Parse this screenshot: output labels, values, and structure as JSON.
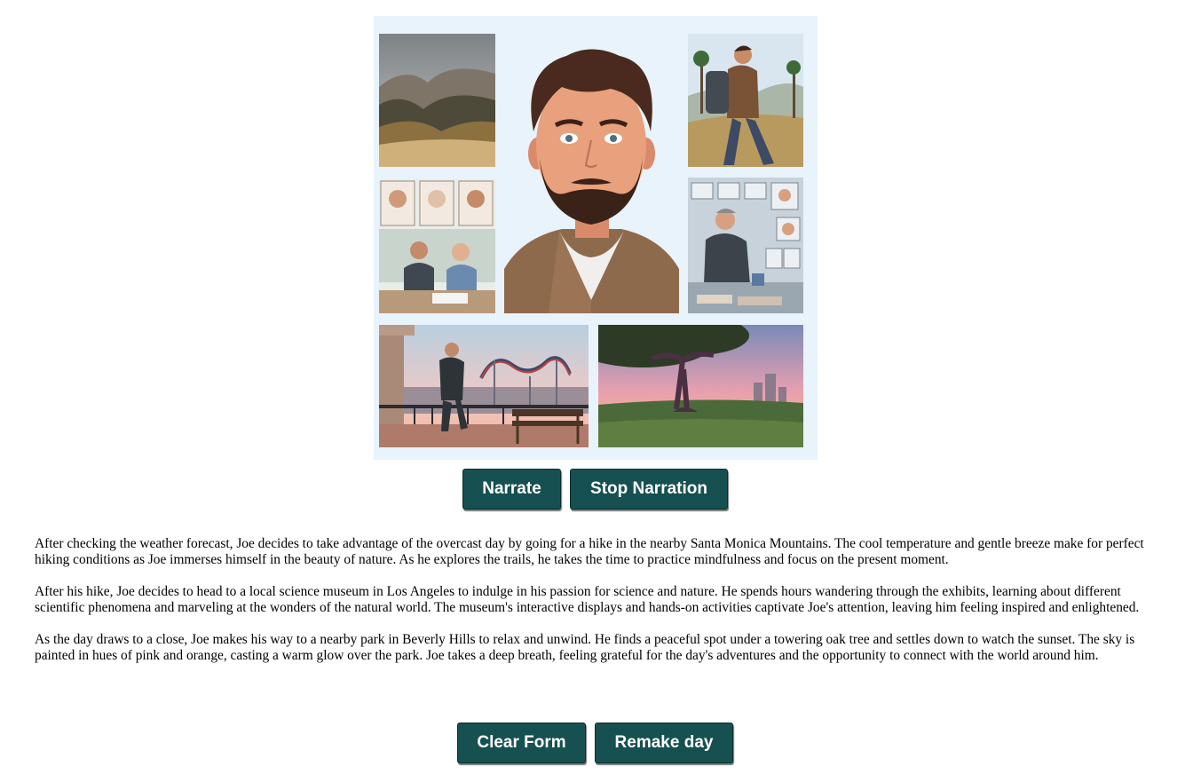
{
  "colors": {
    "button_bg": "#175050",
    "button_text": "#ffffff",
    "collage_bg": "#e8f3fc"
  },
  "collage": {
    "panels": [
      {
        "name": "misty-mountains-image",
        "icon": "landscape"
      },
      {
        "name": "joe-portrait-image",
        "icon": "portrait"
      },
      {
        "name": "hiking-joe-image",
        "icon": "hiker"
      },
      {
        "name": "museum-meeting-image",
        "icon": "people"
      },
      {
        "name": "science-lab-image",
        "icon": "lab"
      },
      {
        "name": "rollercoaster-view-image",
        "icon": "overlook"
      },
      {
        "name": "oak-tree-sunset-image",
        "icon": "tree"
      }
    ]
  },
  "narration": {
    "narrate_label": "Narrate",
    "stop_label": "Stop Narration"
  },
  "story": {
    "paragraphs": [
      "After checking the weather forecast, Joe decides to take advantage of the overcast day by going for a hike in the nearby Santa Monica Mountains. The cool temperature and gentle breeze make for perfect hiking conditions as Joe immerses himself in the beauty of nature. As he explores the trails, he takes the time to practice mindfulness and focus on the present moment.",
      "After his hike, Joe decides to head to a local science museum in Los Angeles to indulge in his passion for science and nature. He spends hours wandering through the exhibits, learning about different scientific phenomena and marveling at the wonders of the natural world. The museum's interactive displays and hands-on activities captivate Joe's attention, leaving him feeling inspired and enlightened.",
      "As the day draws to a close, Joe makes his way to a nearby park in Beverly Hills to relax and unwind. He finds a peaceful spot under a towering oak tree and settles down to watch the sunset. The sky is painted in hues of pink and orange, casting a warm glow over the park. Joe takes a deep breath, feeling grateful for the day's adventures and the opportunity to connect with the world around him."
    ]
  },
  "form": {
    "clear_label": "Clear Form",
    "remake_label": "Remake day"
  }
}
